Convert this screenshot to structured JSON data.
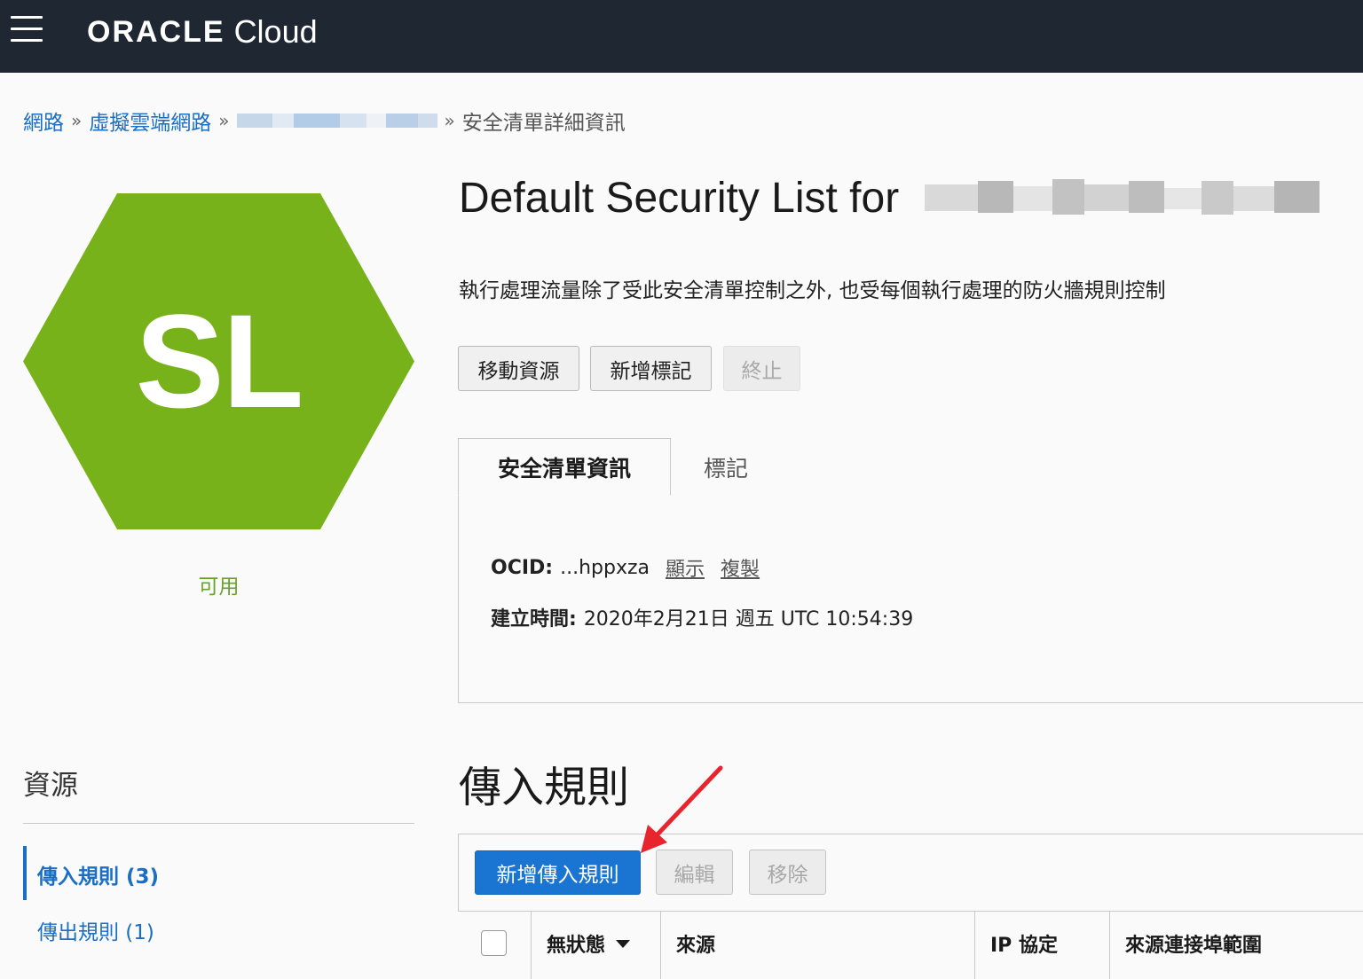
{
  "header": {
    "brand_primary": "ORACLE",
    "brand_secondary": "Cloud",
    "bg_color": "#1f2733"
  },
  "breadcrumb": {
    "items": [
      "網路",
      "虛擬雲端網路"
    ],
    "separator": "»",
    "current": "安全清單詳細資訊"
  },
  "resource_icon": {
    "initials": "SL",
    "color": "#78b21a",
    "status": "可用",
    "status_color": "#6aa12a"
  },
  "page": {
    "title": "Default Security List for",
    "description": "執行處理流量除了受此安全清單控制之外, 也受每個執行處理的防火牆規則控制"
  },
  "actions": {
    "move_resource": "移動資源",
    "add_tags": "新增標記",
    "terminate": "終止"
  },
  "tabs": {
    "info": "安全清單資訊",
    "tags": "標記"
  },
  "details": {
    "ocid_label": "OCID:",
    "ocid_value": "...hppxza",
    "show_link": "顯示",
    "copy_link": "複製",
    "created_label": "建立時間:",
    "created_value": "2020年2月21日 週五 UTC 10:54:39"
  },
  "resources": {
    "title": "資源",
    "items": [
      {
        "label": "傳入規則 (3)",
        "active": true
      },
      {
        "label": "傳出規則 (1)",
        "active": false
      }
    ]
  },
  "ingress": {
    "title": "傳入規則",
    "add_button": "新增傳入規則",
    "edit_button": "編輯",
    "remove_button": "移除",
    "columns": [
      "無狀態",
      "來源",
      "IP 協定",
      "來源連接埠範圍"
    ]
  }
}
